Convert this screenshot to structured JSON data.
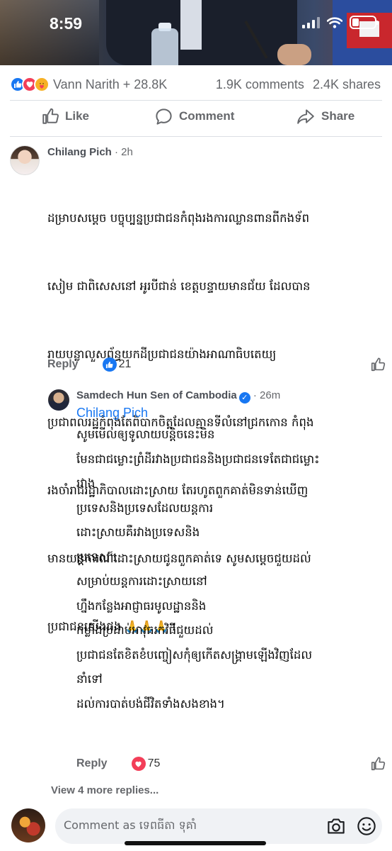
{
  "status_bar": {
    "time": "8:59"
  },
  "post": {
    "reactions": {
      "icons": [
        "like-icon",
        "love-icon",
        "care-icon"
      ],
      "summary": "Vann Narith + 28.8K",
      "comments": "1.9K comments",
      "shares": "2.4K shares"
    },
    "actions": {
      "like": "Like",
      "comment": "Comment",
      "share": "Share"
    }
  },
  "comments": [
    {
      "author": "Chilang Pich",
      "time": "· 2h",
      "lines": [
        "ដម្រាបសម្តេច បច្ចុប្បន្នប្រជាជនកំពុងរងការឈ្លានពានពីកងទ័ព",
        "សៀម ជាពិសេសនៅ អូរបីជាន់ ខេត្តបន្ទាយមានជ័យ ដែលបាន",
        "រាយបន្លាលួសព័ន្ធយកដីប្រជាជនយ៉ាងអាណាធិបតេយ្យ",
        "ប្រជាពលរដ្ឋកំពុងតែពិបាកចិត្តដែលគ្មានទីលំនៅជ្រកកោន កំពុង",
        "រងចាំរាជរដ្ឋាភិបាលដោះស្រាយ តែរហូតពួកគាត់មិនទាន់ឃើញ",
        "មានយន្តការណ៍ដោះស្រាយជូនពួកគាត់ទេ សូមសម្តេចជួយដល់",
        "ប្រជាជនយើងផង 🙏🙏🙏។"
      ],
      "reply_label": "Reply",
      "reaction_count": "21",
      "reaction_icon": "like-icon"
    }
  ],
  "reply": {
    "author": "Samdech Hun Sen of Cambodia",
    "time": "· 26m",
    "mention": "Chilang Pich",
    "lines": [
      "សូមមើលឲ្យទូលាយបន្តិចនេះមិន",
      "មែនជាជម្លោះព្រំដីរវាងប្រជាជននិងប្រជាជនទេតែជាជម្លោះ",
      "រវាង",
      "ប្រទេសនិងប្រទេសដែលយន្តការ",
      "ដោះស្រាយគឺរវាងប្រទេសនិង",
      "ប្រទេស។",
      "សម្រាប់យន្តការដោះស្រាយនៅ",
      "ហ្នឹងកន្លែងអាជ្ញាធរមូលដ្ឋាននិង",
      "កម្លាំងប្រដាប់អាវុធរកវិធីជួយដល់",
      "ប្រជាជនតែខិតខំបញ្ចៀសកុំឲ្យកើតសង្គ្រាមឡើងវិញដែល",
      "នាំទៅ",
      "ដល់ការបាត់បង់ជីវិតទាំងសងខាង។"
    ],
    "reply_label": "Reply",
    "reaction_count": "75",
    "reaction_icon": "love-icon"
  },
  "view_more": "View 4 more replies...",
  "composer": {
    "placeholder": "Comment as ទេពធីតា ទុគាំ"
  }
}
